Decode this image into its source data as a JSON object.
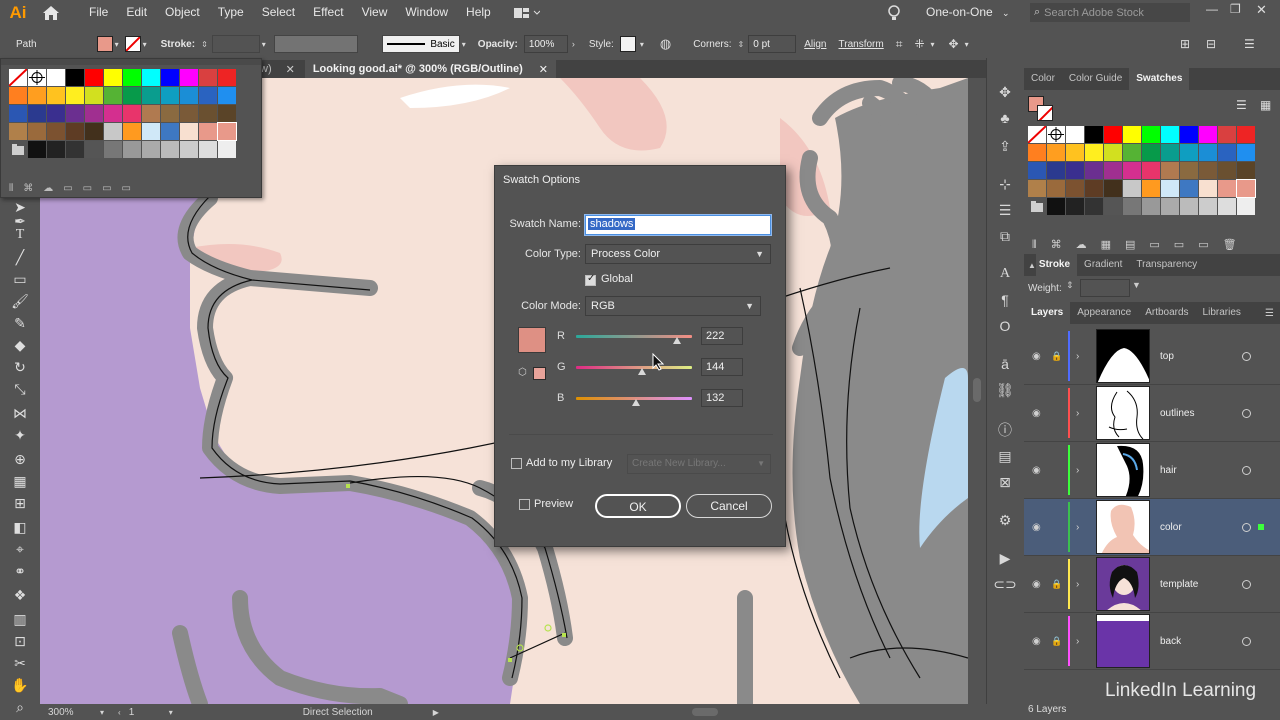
{
  "app": {
    "logo": "Ai",
    "workspace": "One-on-One",
    "search_placeholder": "Search Adobe Stock"
  },
  "menu": [
    "File",
    "Edit",
    "Object",
    "Type",
    "Select",
    "Effect",
    "View",
    "Window",
    "Help"
  ],
  "control_bar": {
    "selection": "Path",
    "stroke_label": "Stroke:",
    "brush": "Basic",
    "opacity_label": "Opacity:",
    "opacity_value": "100%",
    "style_label": "Style:",
    "corners_label": "Corners:",
    "corners_value": "0 pt",
    "align": "Align",
    "transform": "Transform"
  },
  "document_tab": {
    "title": "Looking good.ai* @ 300% (RGB/Outline)",
    "prev_tab_fragment": "w)"
  },
  "dialog": {
    "title": "Swatch Options",
    "swatch_name_label": "Swatch Name:",
    "swatch_name_value": "shadows",
    "color_type_label": "Color Type:",
    "color_type_value": "Process Color",
    "global_label": "Global",
    "global_checked": true,
    "color_mode_label": "Color Mode:",
    "color_mode_value": "RGB",
    "channels": [
      {
        "label": "R",
        "value": "222",
        "level": 222
      },
      {
        "label": "G",
        "value": "144",
        "level": 144
      },
      {
        "label": "B",
        "value": "132",
        "level": 132
      }
    ],
    "swatch_color": "#DE9084",
    "library_label": "Add to my Library",
    "library_select": "Create New Library...",
    "preview_label": "Preview",
    "ok_label": "OK",
    "cancel_label": "Cancel"
  },
  "right_panels": {
    "color_tabs": [
      "Color",
      "Color Guide",
      "Swatches"
    ],
    "stroke_tabs": [
      "Stroke",
      "Gradient",
      "Transparency"
    ],
    "weight_label": "Weight:",
    "layer_tabs": [
      "Layers",
      "Appearance",
      "Artboards",
      "Libraries"
    ],
    "layers": [
      {
        "name": "top",
        "color": "#4f6cff",
        "locked": true,
        "selected": false
      },
      {
        "name": "outlines",
        "color": "#ff4f4f",
        "locked": false,
        "selected": false
      },
      {
        "name": "hair",
        "color": "#3cff3c",
        "locked": false,
        "selected": false
      },
      {
        "name": "color",
        "color": "#3cc04f",
        "locked": false,
        "selected": true
      },
      {
        "name": "template",
        "color": "#ffe84f",
        "locked": true,
        "selected": false
      },
      {
        "name": "back",
        "color": "#ff4fff",
        "locked": true,
        "selected": false
      }
    ],
    "layers_count": "6 Layers"
  },
  "status": {
    "zoom": "300%",
    "artboard": "1",
    "tool": "Direct Selection"
  },
  "watermark": "LinkedIn Learning",
  "colors": {
    "ui_bg": "#535353",
    "canvas_skin": "#f6e2d8",
    "purple": "#b59ad0",
    "selection": "#4b5d7a"
  }
}
